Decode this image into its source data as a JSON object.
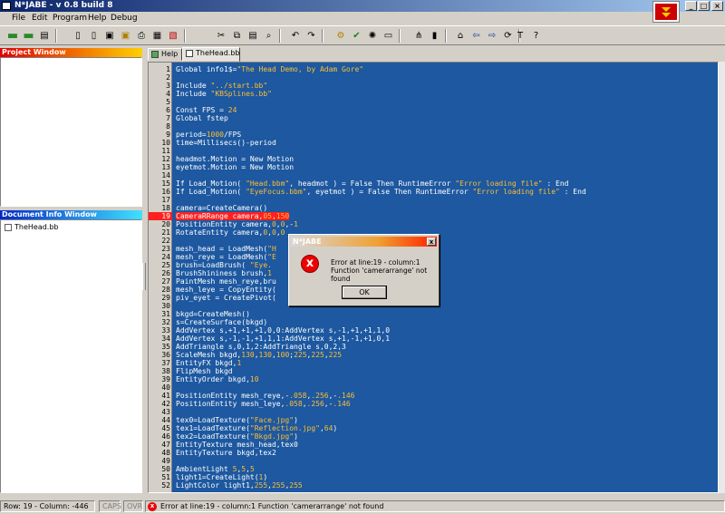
{
  "window": {
    "title": "N*JABE - v 0.8 build 8"
  },
  "title_buttons": {
    "minimize": "_",
    "maximize": "□",
    "close": "×"
  },
  "menu": [
    "File",
    "Edit",
    "Program",
    "Help",
    "Debug"
  ],
  "toolbar": {
    "groups": [
      [
        "new-folder-icon",
        "open-folder-icon",
        "save-icon"
      ],
      [
        "new-file-icon",
        "open-file-icon",
        "save-file-icon",
        "save-all-icon",
        "print-icon",
        "export-icon",
        "close-file-icon"
      ],
      [
        "cut-icon",
        "copy-icon",
        "paste-icon",
        "find-icon"
      ],
      [
        "undo-icon",
        "redo-icon"
      ],
      [
        "compile-icon",
        "check-icon",
        "settings-icon",
        "window-icon"
      ],
      [
        "tree-icon",
        "debug-icon"
      ],
      [
        "home-icon",
        "back-icon",
        "forward-icon",
        "refresh-icon"
      ],
      [
        "tools-icon",
        "help-icon"
      ]
    ],
    "glyphs": {
      "new-folder-icon": "▬",
      "open-folder-icon": "▬",
      "save-icon": "▤",
      "new-file-icon": "▯",
      "open-file-icon": "▯",
      "save-file-icon": "▣",
      "save-all-icon": "▣",
      "print-icon": "⎙",
      "export-icon": "▦",
      "close-file-icon": "▧",
      "cut-icon": "✂",
      "copy-icon": "⧉",
      "paste-icon": "▤",
      "find-icon": "⌕",
      "undo-icon": "↶",
      "redo-icon": "↷",
      "compile-icon": "⚙",
      "check-icon": "✔",
      "settings-icon": "✺",
      "window-icon": "▭",
      "tree-icon": "⋔",
      "debug-icon": "▮",
      "home-icon": "⌂",
      "back-icon": "⇦",
      "forward-icon": "⇨",
      "refresh-icon": "⟳",
      "tools-icon": "T",
      "help-icon": "?"
    }
  },
  "project_panel": {
    "title": "Project Window"
  },
  "document_panel": {
    "title": "Document Info Window",
    "items": [
      "TheHead.bb"
    ]
  },
  "tabs": [
    {
      "label": "Help"
    },
    {
      "label": "TheHead.bb",
      "active": true
    }
  ],
  "code": [
    {
      "n": "1",
      "segs": [
        [
          "Global info1$=",
          ""
        ],
        [
          "\"The Head Demo, by Adam Gore\"",
          "str"
        ]
      ]
    },
    {
      "n": "2",
      "segs": []
    },
    {
      "n": "3",
      "segs": [
        [
          "Include ",
          ""
        ],
        [
          "\"../start.bb\"",
          "str"
        ]
      ]
    },
    {
      "n": "4",
      "segs": [
        [
          "Include ",
          ""
        ],
        [
          "\"KBSplines.bb\"",
          "str"
        ]
      ]
    },
    {
      "n": "5",
      "segs": []
    },
    {
      "n": "6",
      "segs": [
        [
          "Const FPS = ",
          ""
        ],
        [
          "24",
          "num"
        ]
      ]
    },
    {
      "n": "7",
      "segs": [
        [
          "Global fstep",
          ""
        ]
      ]
    },
    {
      "n": "8",
      "segs": []
    },
    {
      "n": "9",
      "segs": [
        [
          "period=",
          ""
        ],
        [
          "1000",
          "num"
        ],
        [
          "/FPS",
          ""
        ]
      ]
    },
    {
      "n": "10",
      "segs": [
        [
          "time=Millisecs()-period",
          ""
        ]
      ]
    },
    {
      "n": "11",
      "segs": []
    },
    {
      "n": "12",
      "segs": [
        [
          "headmot.Motion = New Motion",
          ""
        ]
      ]
    },
    {
      "n": "13",
      "segs": [
        [
          "eyetmot.Motion = New Motion",
          ""
        ]
      ]
    },
    {
      "n": "14",
      "segs": []
    },
    {
      "n": "15",
      "segs": [
        [
          "If Load_Motion( ",
          ""
        ],
        [
          "\"Head.bbm\"",
          "str"
        ],
        [
          ", headmot ) = False Then RuntimeError ",
          ""
        ],
        [
          "\"Error loading file\"",
          "str"
        ],
        [
          " : End",
          ""
        ]
      ]
    },
    {
      "n": "16",
      "segs": [
        [
          "If Load_Motion( ",
          ""
        ],
        [
          "\"EyeFocus.bbm\"",
          "str"
        ],
        [
          ", eyetmot ) = False Then RuntimeError ",
          ""
        ],
        [
          "\"Error loading file\"",
          "str"
        ],
        [
          " : End",
          ""
        ]
      ]
    },
    {
      "n": "17",
      "segs": []
    },
    {
      "n": "18",
      "segs": [
        [
          "camera=CreateCamera()",
          ""
        ]
      ]
    },
    {
      "n": "19",
      "err": true,
      "segs": [
        [
          "CameraRRange camera,",
          ""
        ],
        [
          "05",
          "num"
        ],
        [
          ",",
          ""
        ],
        [
          "150",
          "num"
        ]
      ]
    },
    {
      "n": "20",
      "segs": [
        [
          "PositionEntity camera,",
          ""
        ],
        [
          "0",
          "num"
        ],
        [
          ",",
          ""
        ],
        [
          "0",
          "num"
        ],
        [
          ",-",
          ""
        ],
        [
          "1",
          "num"
        ]
      ]
    },
    {
      "n": "21",
      "segs": [
        [
          "RotateEntity camera,",
          ""
        ],
        [
          "0",
          "num"
        ],
        [
          ",",
          ""
        ],
        [
          "0",
          "num"
        ],
        [
          ",",
          ""
        ],
        [
          "0",
          "num"
        ]
      ]
    },
    {
      "n": "22",
      "segs": []
    },
    {
      "n": "23",
      "segs": [
        [
          "mesh_head = LoadMesh(",
          ""
        ],
        [
          "\"H",
          "str"
        ]
      ]
    },
    {
      "n": "24",
      "segs": [
        [
          "mesh_reye = LoadMesh(",
          ""
        ],
        [
          "\"E",
          "str"
        ]
      ]
    },
    {
      "n": "25",
      "segs": [
        [
          "brush=LoadBrush( ",
          ""
        ],
        [
          "\"Eye.",
          "str"
        ]
      ]
    },
    {
      "n": "26",
      "segs": [
        [
          "BrushShininess brush,",
          ""
        ],
        [
          "1",
          "num"
        ]
      ]
    },
    {
      "n": "27",
      "segs": [
        [
          "PaintMesh mesh_reye,bru",
          ""
        ]
      ]
    },
    {
      "n": "28",
      "segs": [
        [
          "mesh_leye = CopyEntity(",
          ""
        ]
      ]
    },
    {
      "n": "29",
      "segs": [
        [
          "piv_eyet = CreatePivot(",
          ""
        ]
      ]
    },
    {
      "n": "30",
      "segs": []
    },
    {
      "n": "31",
      "segs": [
        [
          "bkgd=CreateMesh()",
          ""
        ]
      ]
    },
    {
      "n": "32",
      "segs": [
        [
          "s=CreateSurface(bkgd)",
          ""
        ]
      ]
    },
    {
      "n": "33",
      "segs": [
        [
          "AddVertex s,+1,+1,+1,0,0:AddVertex s,-1,+1,+1,1,0",
          ""
        ]
      ]
    },
    {
      "n": "34",
      "segs": [
        [
          "AddVertex s,-1,-1,+1,1,1:AddVertex s,+1,-1,+1,0,1",
          ""
        ]
      ]
    },
    {
      "n": "35",
      "segs": [
        [
          "AddTriangle s,0,1,2:AddTriangle s,0,2,3",
          ""
        ]
      ]
    },
    {
      "n": "36",
      "segs": [
        [
          "ScaleMesh bkgd,",
          ""
        ],
        [
          "130",
          "num"
        ],
        [
          ",",
          ""
        ],
        [
          "130",
          "num"
        ],
        [
          ",",
          ""
        ],
        [
          "100",
          "num"
        ],
        [
          ";",
          ""
        ],
        [
          "225",
          "num"
        ],
        [
          ",",
          ""
        ],
        [
          "225",
          "num"
        ],
        [
          ",",
          ""
        ],
        [
          "225",
          "num"
        ]
      ]
    },
    {
      "n": "37",
      "segs": [
        [
          "EntityFX bkgd,",
          ""
        ],
        [
          "1",
          "num"
        ]
      ]
    },
    {
      "n": "38",
      "segs": [
        [
          "FlipMesh bkgd",
          ""
        ]
      ]
    },
    {
      "n": "39",
      "segs": [
        [
          "EntityOrder bkgd,",
          ""
        ],
        [
          "10",
          "num"
        ]
      ]
    },
    {
      "n": "40",
      "segs": []
    },
    {
      "n": "41",
      "segs": [
        [
          "PositionEntity mesh_reye,-",
          ""
        ],
        [
          ".058",
          "num"
        ],
        [
          ",",
          ""
        ],
        [
          ".256",
          "num"
        ],
        [
          ",-",
          ""
        ],
        [
          ".146",
          "num"
        ]
      ]
    },
    {
      "n": "42",
      "segs": [
        [
          "PositionEntity mesh_leye,",
          ""
        ],
        [
          ".058",
          "num"
        ],
        [
          ",",
          ""
        ],
        [
          ".256",
          "num"
        ],
        [
          ",-",
          ""
        ],
        [
          ".146",
          "num"
        ]
      ]
    },
    {
      "n": "43",
      "segs": []
    },
    {
      "n": "44",
      "segs": [
        [
          "tex0=LoadTexture(",
          ""
        ],
        [
          "\"Face.jpg\"",
          "str"
        ],
        [
          ")",
          ""
        ]
      ]
    },
    {
      "n": "45",
      "segs": [
        [
          "tex1=LoadTexture(",
          ""
        ],
        [
          "\"Reflection.jpg\"",
          "str"
        ],
        [
          ",",
          ""
        ],
        [
          "64",
          "num"
        ],
        [
          ")",
          ""
        ]
      ]
    },
    {
      "n": "46",
      "segs": [
        [
          "tex2=LoadTexture(",
          ""
        ],
        [
          "\"Bkgd.jpg\"",
          "str"
        ],
        [
          ")",
          ""
        ]
      ]
    },
    {
      "n": "47",
      "segs": [
        [
          "EntityTexture mesh_head,tex0",
          ""
        ]
      ]
    },
    {
      "n": "48",
      "segs": [
        [
          "EntityTexture bkgd,tex2",
          ""
        ]
      ]
    },
    {
      "n": "49",
      "segs": []
    },
    {
      "n": "50",
      "segs": [
        [
          "AmbientLight ",
          ""
        ],
        [
          "5",
          "num"
        ],
        [
          ",",
          ""
        ],
        [
          "5",
          "num"
        ],
        [
          ",",
          ""
        ],
        [
          "5",
          "num"
        ]
      ]
    },
    {
      "n": "51",
      "segs": [
        [
          "light1=CreateLight(",
          ""
        ],
        [
          "1",
          "num"
        ],
        [
          ")",
          ""
        ]
      ]
    },
    {
      "n": "52",
      "segs": [
        [
          "LightColor light1,",
          ""
        ],
        [
          "255",
          "num"
        ],
        [
          ",",
          ""
        ],
        [
          "255",
          "num"
        ],
        [
          ",",
          ""
        ],
        [
          "255",
          "num"
        ]
      ]
    }
  ],
  "dialog": {
    "title": "N*JABE",
    "close": "x",
    "icon": "x",
    "line1": "Error at line:19 - column:1",
    "line2": "Function 'camerarrange' not found",
    "ok_label": "OK"
  },
  "status": {
    "position": "Row: 19 - Column: -446",
    "caps": "CAPS",
    "ovr": "OVR",
    "error_icon": "x",
    "message": "Error at line:19 - column:1  Function 'camerarrange' not found"
  }
}
